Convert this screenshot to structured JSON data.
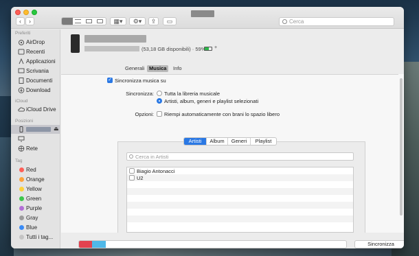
{
  "toolbar": {
    "search_placeholder": "Cerca",
    "back_icon": "chevron-left-icon",
    "forward_icon": "chevron-right-icon"
  },
  "sidebar": {
    "favorites_header": "Preferiti",
    "favorites": [
      {
        "label": "AirDrop",
        "icon": "airdrop-icon"
      },
      {
        "label": "Recenti",
        "icon": "clock-icon"
      },
      {
        "label": "Applicazioni",
        "icon": "apps-icon"
      },
      {
        "label": "Scrivania",
        "icon": "desktop-icon"
      },
      {
        "label": "Documenti",
        "icon": "document-icon"
      },
      {
        "label": "Download",
        "icon": "download-icon"
      }
    ],
    "icloud_header": "iCloud",
    "icloud": [
      {
        "label": "iCloud Drive",
        "icon": "cloud-icon"
      }
    ],
    "locations_header": "Posizioni",
    "locations": [
      {
        "label": "Rete",
        "icon": "network-icon"
      }
    ],
    "tags_header": "Tag",
    "tags": [
      {
        "label": "Red",
        "color": "#fe5f57"
      },
      {
        "label": "Orange",
        "color": "#fda33b"
      },
      {
        "label": "Yellow",
        "color": "#fdd13a"
      },
      {
        "label": "Green",
        "color": "#3ec74b"
      },
      {
        "label": "Purple",
        "color": "#b26fd6"
      },
      {
        "label": "Gray",
        "color": "#9a9a9a"
      },
      {
        "label": "Blue",
        "color": "#3a8bf5"
      },
      {
        "label": "Tutti i tag...",
        "color": "#c4c4c4"
      }
    ]
  },
  "device": {
    "storage": "(53,18 GB disponibili) · 59%",
    "battery_level": 0.59
  },
  "tabs": [
    {
      "label": "Generali",
      "active": false
    },
    {
      "label": "Musica",
      "active": true
    },
    {
      "label": "Info",
      "active": false
    }
  ],
  "music": {
    "sync_checkbox": "Sincronizza musica su",
    "sync_label": "Sincronizza:",
    "option_all": "Tutta la libreria musicale",
    "option_selected": "Artisti, album, generi e playlist selezionati",
    "options_label": "Opzioni:",
    "autofill": "Riempi automaticamente con brani lo spazio libero"
  },
  "segments": [
    "Artisti",
    "Album",
    "Generi",
    "Playlist"
  ],
  "filter_placeholder": "Cerca in Artisti",
  "artists": [
    "Biagio Antonacci",
    "U2"
  ],
  "footer": {
    "sync_button": "Sincronizza",
    "storage_colors": [
      "#e2424f",
      "#4fb8e8"
    ]
  }
}
